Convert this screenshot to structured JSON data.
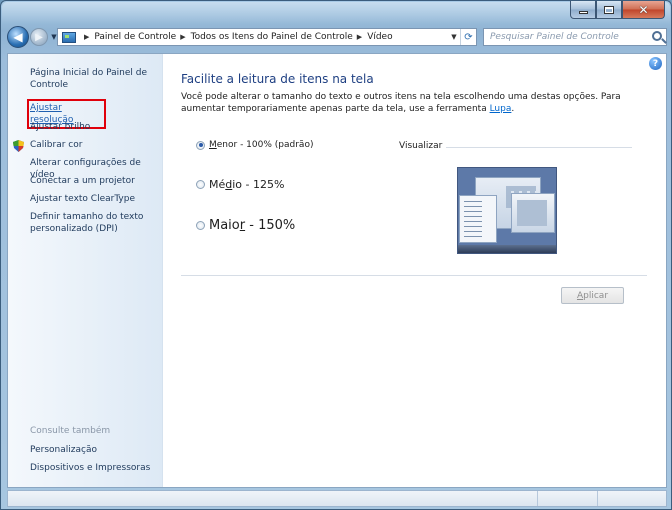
{
  "window": {
    "controls": {
      "minimize": "minimize",
      "maximize": "maximize",
      "close": "close"
    }
  },
  "navbar": {
    "breadcrumbs": [
      "Painel de Controle",
      "Todos os Itens do Painel de Controle",
      "Vídeo"
    ],
    "search_placeholder": "Pesquisar Painel de Controle"
  },
  "sidebar": {
    "items": [
      {
        "label": "Página Inicial do Painel de Controle"
      },
      {
        "label": "Ajustar resolução",
        "highlighted": true
      },
      {
        "label": "Ajustar brilho"
      },
      {
        "label": "Calibrar cor",
        "icon": "shield-icon"
      },
      {
        "label": "Alterar configurações de vídeo"
      },
      {
        "label": "Conectar a um projetor"
      },
      {
        "label": "Ajustar texto ClearType"
      },
      {
        "label": "Definir tamanho do texto personalizado (DPI)"
      }
    ],
    "see_also_heading": "Consulte também",
    "see_also_items": [
      {
        "label": "Personalização"
      },
      {
        "label": "Dispositivos e Impressoras"
      }
    ]
  },
  "main": {
    "title": "Facilite a leitura de itens na tela",
    "description_prefix": "Você pode alterar o tamanho do texto e outros itens na tela escolhendo uma destas opções. Para aumentar temporariamente apenas parte da tela, use a ferramenta ",
    "description_link": "Lupa",
    "description_suffix": ".",
    "options": [
      {
        "pre": "",
        "accel": "M",
        "post": "enor - 100% (padrão)",
        "selected": true
      },
      {
        "pre": "Mé",
        "accel": "d",
        "post": "io - 125%",
        "selected": false
      },
      {
        "pre": "Maio",
        "accel": "r",
        "post": " - 150%",
        "selected": false
      }
    ],
    "preview_label": "Visualizar",
    "apply": {
      "accel": "A",
      "rest": "plicar"
    }
  },
  "colors": {
    "highlight_outline": "#e0000b",
    "link": "#1e395b",
    "title": "#1e3f82"
  }
}
